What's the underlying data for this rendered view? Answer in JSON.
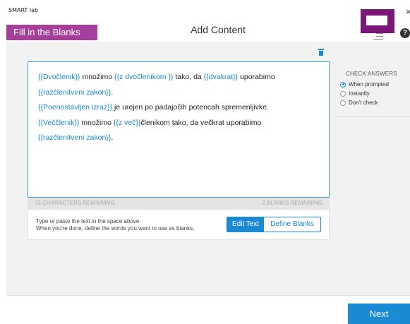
{
  "window": {
    "title": "SMART lab",
    "close_glyph": "×"
  },
  "header": {
    "activity_label": "Fill in the Blanks",
    "title": "Add Content",
    "help_glyph": "?",
    "accent_color": "#a53f9b",
    "logo_color": "#7a1778"
  },
  "icons": {
    "delete": "trash-icon",
    "menu": "hamburger-menu-icon",
    "help": "question-icon",
    "logo": "smart-lab-logo-icon"
  },
  "editor": {
    "paragraphs": [
      [
        {
          "text": "{{Dvočlenik}}",
          "blank": true
        },
        {
          "text": " množimo ",
          "blank": false
        },
        {
          "text": "{{z dvočlenikom }}",
          "blank": true
        },
        {
          "text": " tako, da ",
          "blank": false
        },
        {
          "text": "{{dvakrat}}",
          "blank": true
        },
        {
          "text": " uporabimo",
          "blank": false
        }
      ],
      [
        {
          "text": "{{razčlenitveni zakon}}",
          "blank": true
        },
        {
          "text": ".",
          "blank": false
        }
      ],
      [
        {
          "text": "{{Poenostavljen izraz}}",
          "blank": true
        },
        {
          "text": " je urejen po padajočih potencah spremenljivke.",
          "blank": false
        }
      ],
      [
        {
          "text": "{{Veččlenik}}",
          "blank": true
        },
        {
          "text": " množimo ",
          "blank": false
        },
        {
          "text": "{{z več}}",
          "blank": true
        },
        {
          "text": "členikom tako, da večkrat uporabimo",
          "blank": false
        }
      ],
      [
        {
          "text": "{{razčlenitveni zakon}}",
          "blank": true
        },
        {
          "text": ".",
          "blank": false
        }
      ]
    ],
    "characters_remaining": "72 CHARACTERS REMAINING",
    "blanks_remaining": "2 BLANKS REMAINING"
  },
  "instructions": {
    "line1": "Type or paste the text in the space above.",
    "line2": "When you're done, define the words you want to use as blanks."
  },
  "mode_toggle": {
    "edit_label": "Edit Text",
    "define_label": "Define Blanks",
    "selected": "Edit Text"
  },
  "check_answers": {
    "title": "CHECK ANSWERS",
    "options": [
      {
        "label": "When prompted",
        "selected": true
      },
      {
        "label": "Instantly",
        "selected": false
      },
      {
        "label": "Don't check",
        "selected": false
      }
    ]
  },
  "footer": {
    "next_label": "Next",
    "primary_color": "#1a8ad4"
  }
}
